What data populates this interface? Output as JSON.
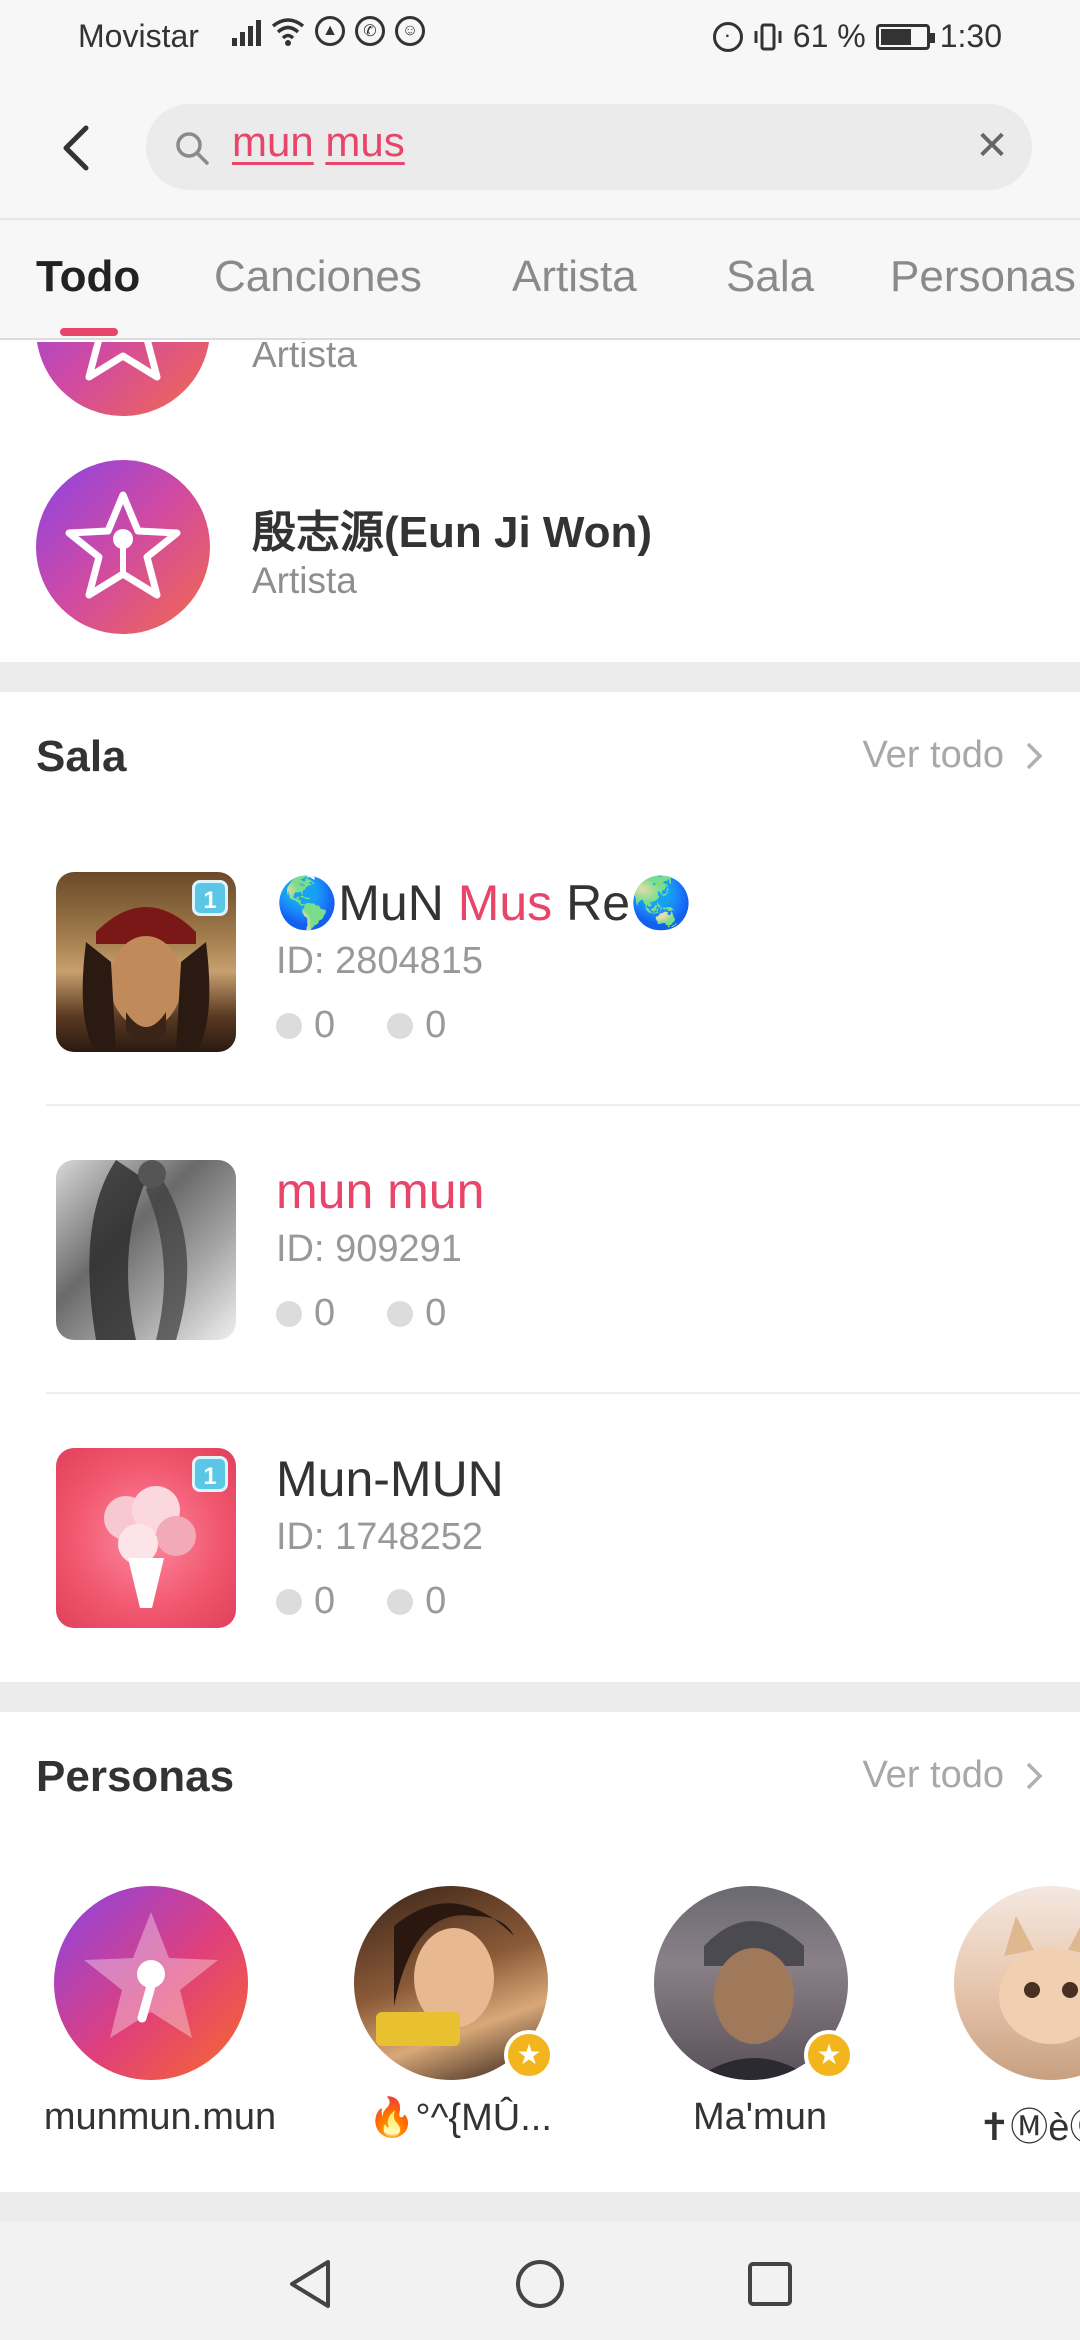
{
  "status_bar": {
    "carrier": "Movistar",
    "battery_text": "61 %",
    "time": "1:30"
  },
  "search": {
    "query_words": [
      "mun",
      "mus"
    ],
    "clear_icon": "close-icon"
  },
  "tabs": [
    {
      "label": "Todo",
      "active": true
    },
    {
      "label": "Canciones",
      "active": false
    },
    {
      "label": "Artista",
      "active": false
    },
    {
      "label": "Sala",
      "active": false
    },
    {
      "label": "Personas",
      "active": false
    }
  ],
  "artists": [
    {
      "name": "",
      "type": "Artista"
    },
    {
      "name": "殷志源(Eun Ji Won)",
      "type": "Artista"
    }
  ],
  "sala": {
    "title": "Sala",
    "see_all": "Ver todo",
    "rooms": [
      {
        "title_pre": "🌎MuN ",
        "title_hl": "Mus",
        "title_post": " Re🌏",
        "id": "ID: 2804815",
        "mics": "0",
        "users": "0",
        "level": "1"
      },
      {
        "title_pre": "",
        "title_hl": "mun mun",
        "title_post": "",
        "id": "ID: 909291",
        "mics": "0",
        "users": "0",
        "level": ""
      },
      {
        "title_pre": "Mun-MUN",
        "title_hl": "",
        "title_post": "",
        "id": "ID: 1748252",
        "mics": "0",
        "users": "0",
        "level": "1"
      }
    ]
  },
  "personas": {
    "title": "Personas",
    "see_all": "Ver todo",
    "people": [
      {
        "name": "munmun.mun",
        "vip": false
      },
      {
        "name": "🔥°^{MÛ...",
        "vip": true
      },
      {
        "name": "Ma'mun",
        "vip": true
      },
      {
        "name": "✝ⓂèⓄ♎",
        "vip": false
      }
    ]
  },
  "colors": {
    "accent": "#e8456a",
    "background": "#ffffff",
    "header_bg": "#f7f7f7",
    "muted_text": "#8e8e8e",
    "divider": "#ececec"
  }
}
